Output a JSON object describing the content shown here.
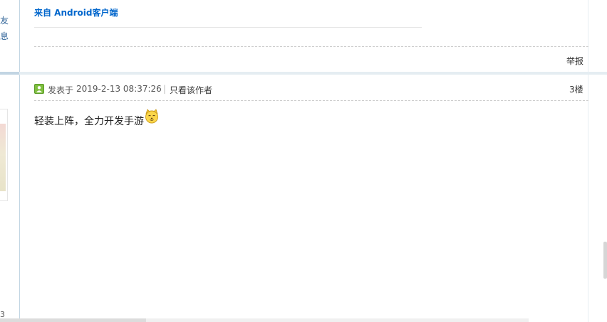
{
  "left_column": {
    "fragment_1": "友",
    "fragment_2": "息",
    "bottom_fragment": "3"
  },
  "previous_post": {
    "client_signature": "来自 Android客户端",
    "report_label": "举报"
  },
  "post": {
    "posted_label": "发表于",
    "timestamp": "2019-2-13 08:37:26",
    "separator": "|",
    "author_only_label": "只看该作者",
    "floor": "3楼",
    "content": "轻装上阵，全力开发手游",
    "emoji_icon": "dog-face-emoji-icon"
  },
  "colors": {
    "link_blue": "#0066cc",
    "border_light_blue": "#c2d5e3",
    "separator_blue": "#e5edf2",
    "online_icon_green": "#7fbf3f"
  }
}
